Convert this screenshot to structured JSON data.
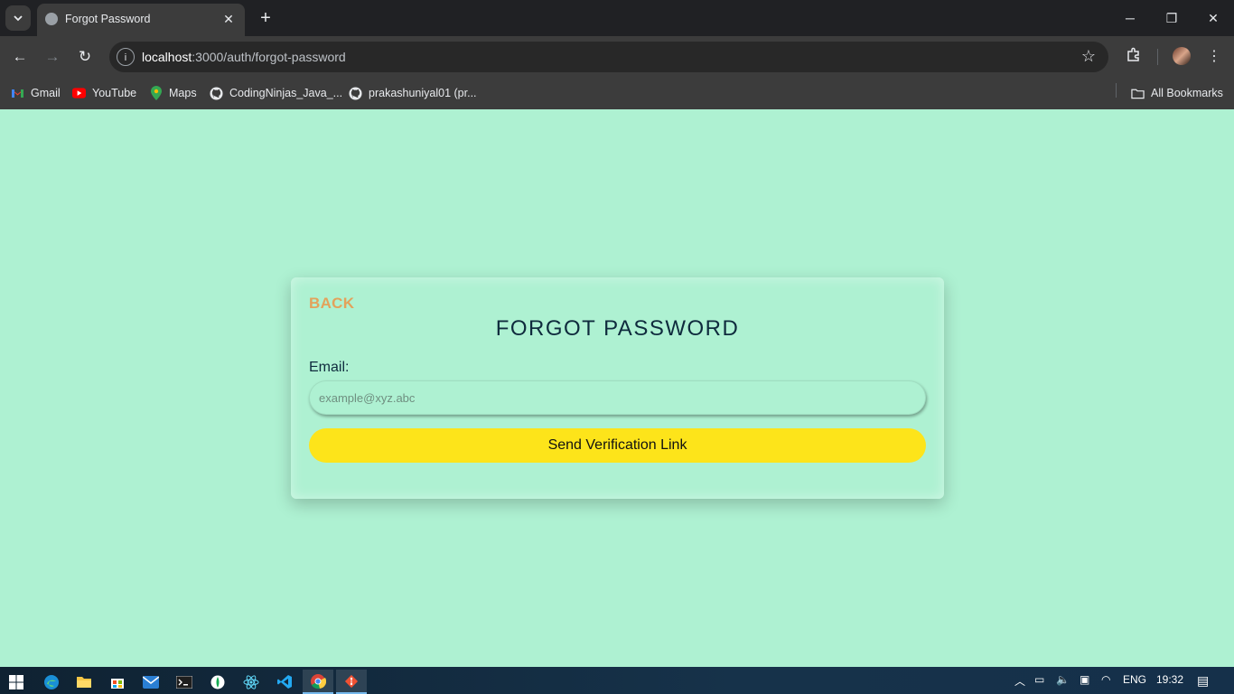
{
  "browser": {
    "tab": {
      "title": "Forgot Password"
    },
    "url": {
      "host": "localhost",
      "rest": ":3000/auth/forgot-password"
    },
    "bookmarks": [
      {
        "label": "Gmail",
        "icon": "gmail-icon"
      },
      {
        "label": "YouTube",
        "icon": "youtube-icon"
      },
      {
        "label": "Maps",
        "icon": "maps-icon"
      },
      {
        "label": "CodingNinjas_Java_...",
        "icon": "github-icon"
      },
      {
        "label": "prakashuniyal01 (pr...",
        "icon": "github-icon"
      }
    ],
    "all_bookmarks": "All Bookmarks"
  },
  "page": {
    "background": "#aef1d2",
    "back_label": "BACK",
    "title": "FORGOT PASSWORD",
    "email_label": "Email:",
    "email_placeholder": "example@xyz.abc",
    "email_value": "",
    "submit_label": "Send Verification Link",
    "accent_back": "#e3a25b",
    "button_color": "#fde41a"
  },
  "taskbar": {
    "apps": [
      "windows-start-icon",
      "edge-icon",
      "file-explorer-icon",
      "store-icon",
      "mail-icon",
      "terminal-icon",
      "mongodb-compass-icon",
      "react-icon",
      "vscode-icon",
      "chrome-icon",
      "git-icon"
    ],
    "language": "ENG",
    "time": "19:32"
  }
}
